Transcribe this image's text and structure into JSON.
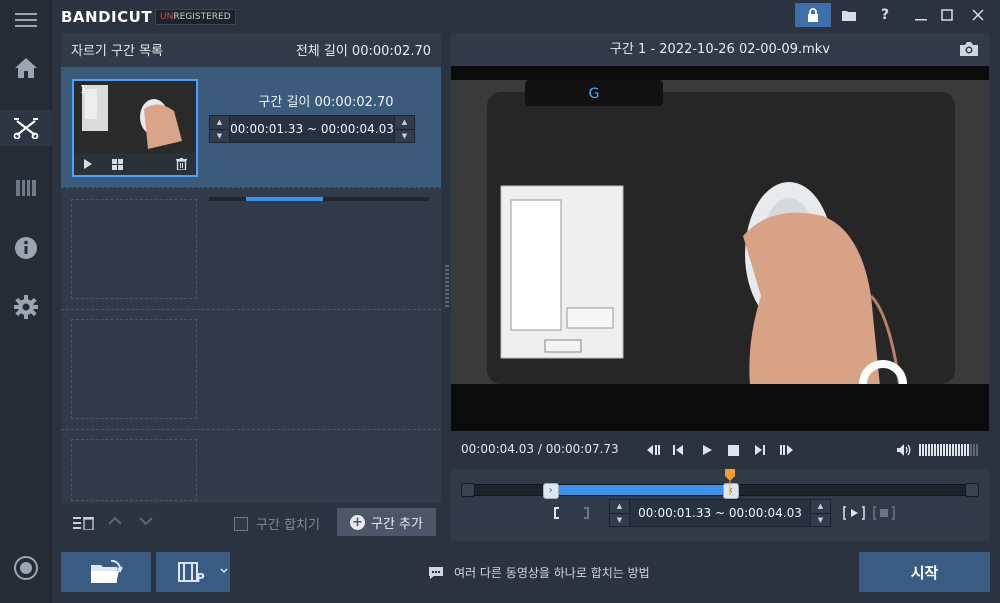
{
  "app": {
    "logo_main": "BANDICUT",
    "badge_un": "UN",
    "badge_rest": "REGISTERED"
  },
  "left_panel": {
    "title": "자르기 구간 목록",
    "total_label": "전체 길이 00:00:02.70",
    "segment": {
      "number": "1",
      "length_label": "구간 길이 00:00:02.70",
      "start": "00:00:01.33",
      "separator": "~",
      "end": "00:00:04.03",
      "progress_start": 0.17,
      "progress_end": 0.52
    },
    "merge_label": "구간 합치기",
    "add_label": "구간 추가"
  },
  "right_panel": {
    "title": "구간 1 - 2022-10-26 02-00-09.mkv",
    "current_time": "00:00:04.03",
    "time_separator": "/",
    "total_time": "00:00:07.73",
    "segment_length_label": "구간 길이 00:00:02.70",
    "range_start": "00:00:01.33",
    "range_separator": "~",
    "range_end": "00:00:04.03",
    "selection_start": 0.172,
    "selection_end": 0.521,
    "volume_level": 0.85
  },
  "bottom_bar": {
    "howto_text": "여러 다른 동영상을 하나로 합치는 방법",
    "start_label": "시작"
  },
  "colors": {
    "accent": "#3b92ea",
    "panel": "#303a48",
    "button": "#3a5c82",
    "unregistered_red": "#ff3b3b",
    "playhead": "#f0a028"
  }
}
